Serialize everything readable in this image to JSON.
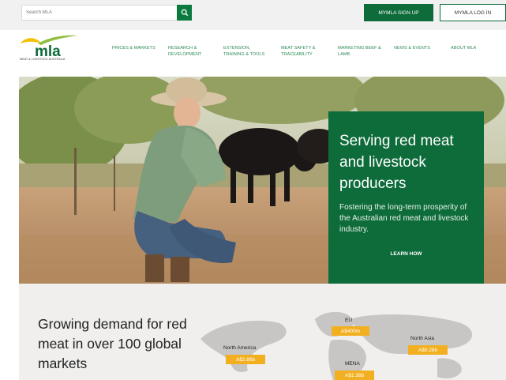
{
  "topbar": {
    "search_placeholder": "Search MLA",
    "search_icon": "search-icon",
    "signup_label": "MYMLA SIGN UP",
    "login_label": "MYMLA LOG IN"
  },
  "logo": {
    "wordmark": "mla",
    "subtitle": "MEAT & LIVESTOCK AUSTRALIA"
  },
  "nav": [
    {
      "name": "nav-prices-markets",
      "line1": "PRICES & MARKETS",
      "line2": ""
    },
    {
      "name": "nav-research-development",
      "line1": "RESEARCH &",
      "line2": "DEVELOPMENT"
    },
    {
      "name": "nav-extension-training-tools",
      "line1": "EXTENSION,",
      "line2": "TRAINING & TOOLS"
    },
    {
      "name": "nav-meat-safety-traceability",
      "line1": "MEAT SAFETY &",
      "line2": "TRACEABILITY"
    },
    {
      "name": "nav-marketing-beef-lamb",
      "line1": "MARKETING BEEF &",
      "line2": "LAMB"
    },
    {
      "name": "nav-news-events",
      "line1": "NEWS & EVENTS",
      "line2": ""
    },
    {
      "name": "nav-about-mla",
      "line1": "ABOUT MLA",
      "line2": ""
    }
  ],
  "hero": {
    "title": "Serving red meat and livestock producers",
    "subtitle": "Fostering the long-term prosperity of the Australian red meat and livestock industry.",
    "link_label": "LEARN HOW"
  },
  "markets": {
    "heading": "Growing demand for red meat in over 100 global markets",
    "regions": [
      {
        "name": "EU",
        "value": "A$400m"
      },
      {
        "name": "North America",
        "value": "A$2.86b"
      },
      {
        "name": "North Asia",
        "value": "A$5.28b"
      },
      {
        "name": "MENA",
        "value": "A$1.36b"
      }
    ]
  },
  "colors": {
    "brand_green": "#0e6b3a",
    "nav_green": "#2e8b57",
    "badge_gold": "#f2b021",
    "logo_yellow": "#f5c000"
  }
}
